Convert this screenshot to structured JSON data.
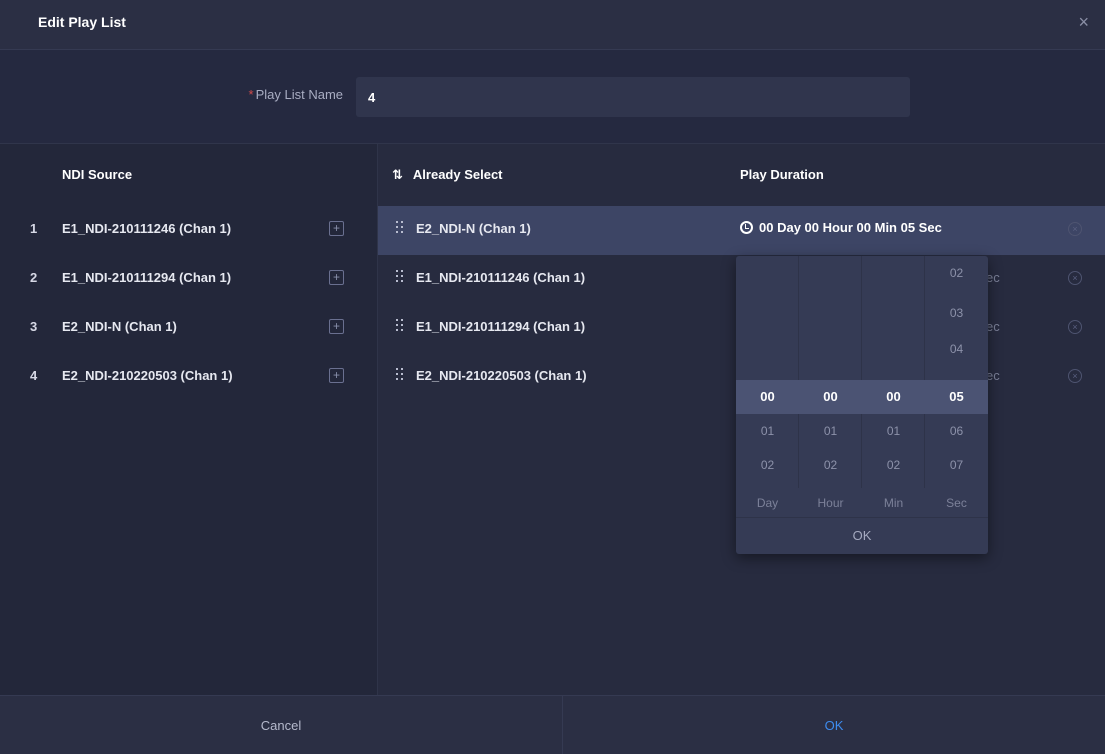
{
  "dialog": {
    "title": "Edit Play List",
    "close_glyph": "×"
  },
  "form": {
    "name_required_mark": "*",
    "name_label": "Play List Name",
    "name_value": "4"
  },
  "ndi_source": {
    "header": "NDI Source",
    "items": [
      {
        "num": "1",
        "name": "E1_NDI-210111246 (Chan 1)"
      },
      {
        "num": "2",
        "name": "E1_NDI-210111294 (Chan 1)"
      },
      {
        "num": "3",
        "name": "E2_NDI-N (Chan 1)"
      },
      {
        "num": "4",
        "name": "E2_NDI-210220503 (Chan 1)"
      }
    ]
  },
  "selected": {
    "header": "Already Select",
    "duration_header": "Play Duration",
    "items": [
      {
        "name": "E2_NDI-N (Chan 1)",
        "duration": "00 Day 00 Hour 00 Min 05 Sec"
      },
      {
        "name": "E1_NDI-210111246 (Chan 1)",
        "duration_visible": "ec"
      },
      {
        "name": "E1_NDI-210111294 (Chan 1)",
        "duration_visible": "ec"
      },
      {
        "name": "E2_NDI-210220503 (Chan 1)",
        "duration_visible": "ec"
      }
    ]
  },
  "time_picker": {
    "day": [
      "00",
      "01",
      "02"
    ],
    "hour": [
      "00",
      "01",
      "02"
    ],
    "min": [
      "00",
      "01",
      "02"
    ],
    "sec": [
      "02",
      "03",
      "04",
      "05",
      "06",
      "07"
    ],
    "units": [
      "Day",
      "Hour",
      "Min",
      "Sec"
    ],
    "ok_label": "OK"
  },
  "footer": {
    "cancel_label": "Cancel",
    "ok_label": "OK"
  },
  "colors": {
    "background": "#272b3f",
    "active_row": "#3d4565",
    "accent": "#3d8cf0"
  }
}
